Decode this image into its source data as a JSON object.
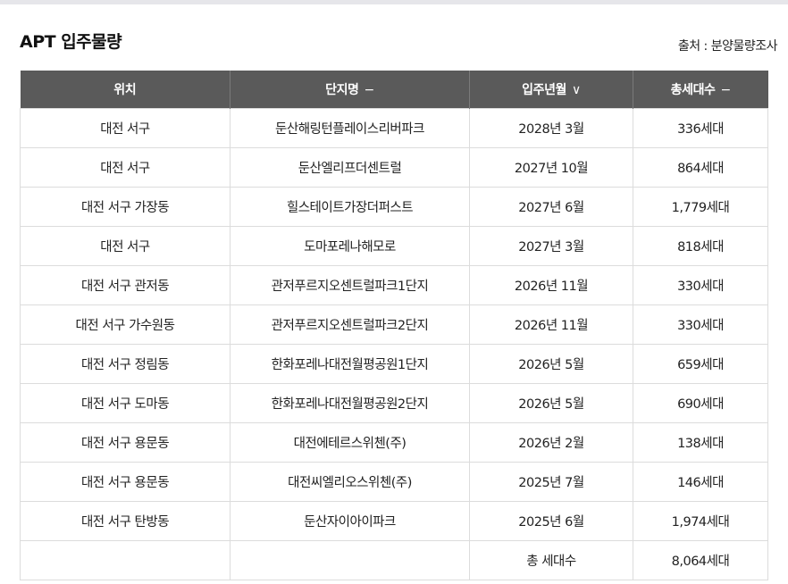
{
  "title": "APT 입주물량",
  "source": "출처 : 분양물량조사",
  "table": {
    "headers": [
      {
        "label": "위치",
        "sort_icon": ""
      },
      {
        "label": "단지명",
        "sort_icon": "−"
      },
      {
        "label": "입주년월",
        "sort_icon": "∨"
      },
      {
        "label": "총세대수",
        "sort_icon": "−"
      }
    ],
    "sort_icon_names": [
      "",
      "minus-icon",
      "chevron-down-icon",
      "minus-icon"
    ],
    "rows": [
      [
        "대전 서구",
        "둔산해링턴플레이스리버파크",
        "2028년 3월",
        "336세대"
      ],
      [
        "대전 서구",
        "둔산엘리프더센트럴",
        "2027년 10월",
        "864세대"
      ],
      [
        "대전 서구 가장동",
        "힐스테이트가장더퍼스트",
        "2027년 6월",
        "1,779세대"
      ],
      [
        "대전 서구",
        "도마포레나해모로",
        "2027년 3월",
        "818세대"
      ],
      [
        "대전 서구 관저동",
        "관저푸르지오센트럴파크1단지",
        "2026년 11월",
        "330세대"
      ],
      [
        "대전 서구 가수원동",
        "관저푸르지오센트럴파크2단지",
        "2026년 11월",
        "330세대"
      ],
      [
        "대전 서구 정림동",
        "한화포레나대전월평공원1단지",
        "2026년 5월",
        "659세대"
      ],
      [
        "대전 서구 도마동",
        "한화포레나대전월평공원2단지",
        "2026년 5월",
        "690세대"
      ],
      [
        "대전 서구 용문동",
        "대전에테르스위첸(주)",
        "2026년 2월",
        "138세대"
      ],
      [
        "대전 서구 용문동",
        "대전씨엘리오스위첸(주)",
        "2025년 7월",
        "146세대"
      ],
      [
        "대전 서구 탄방동",
        "둔산자이아이파크",
        "2025년 6월",
        "1,974세대"
      ],
      [
        "",
        "",
        "총 세대수",
        "8,064세대"
      ]
    ]
  },
  "colors": {
    "header_bg": "#5a5a5a",
    "header_text": "#ffffff",
    "border": "#dcdcdc",
    "topbar": "#e6e6ea"
  }
}
